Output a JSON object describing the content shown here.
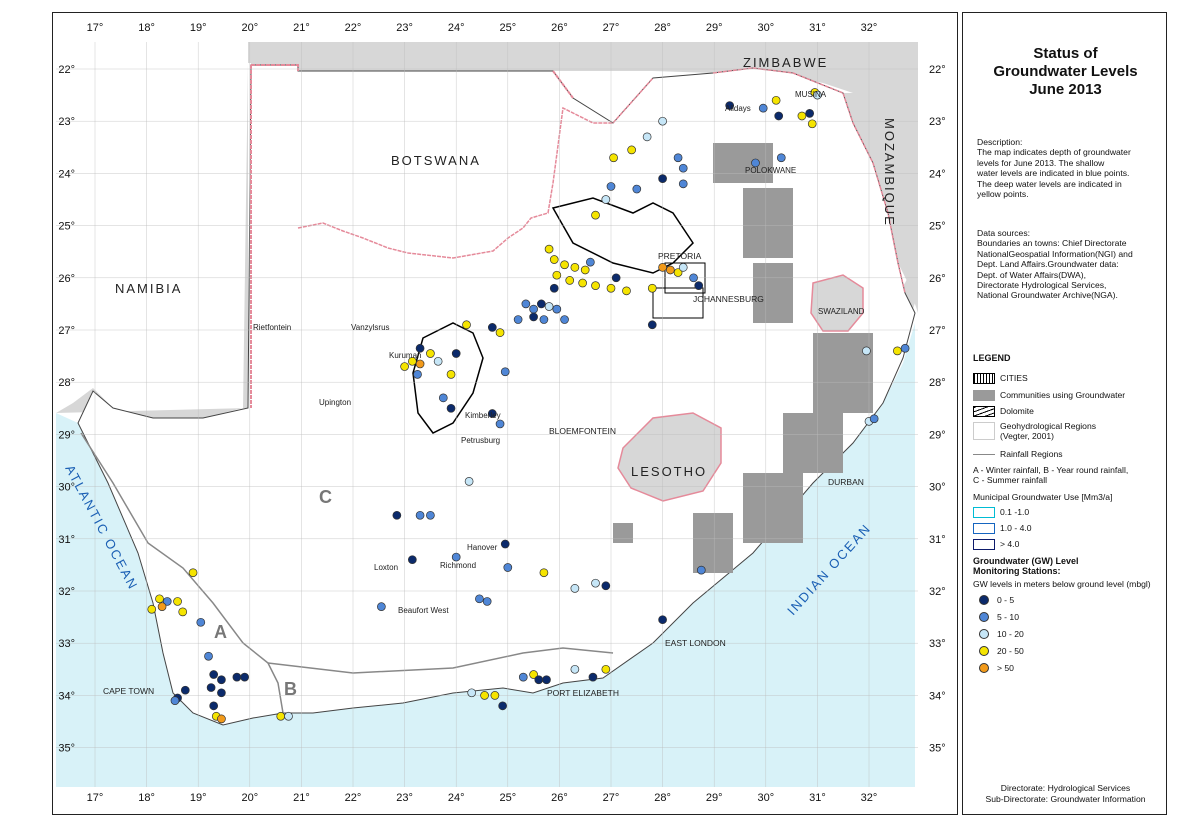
{
  "legend": {
    "title_lines": [
      "Status of",
      "Groundwater Levels",
      "June 2013"
    ],
    "description_lines": [
      "Description:",
      "The map indicates depth of groundwater",
      "levels for June 2013. The shallow",
      "water levels are indicated in blue points.",
      "The deep water levels are indicated in",
      "yellow points."
    ],
    "sources_lines": [
      "Data sources:",
      "Boundaries an towns: Chief Directorate",
      "NationalGeospatial Information(NGI) and",
      "Dept. Land Affairs.Groundwater data:",
      "Dept. of Water Affairs(DWA),",
      "Directorate Hydrological Services,",
      "National Groundwater Archive(NGA)."
    ],
    "heading": "LEGEND",
    "cities": "CITIES",
    "communities": "Communities using Groundwater",
    "dolomite": "Dolomite",
    "geohydro_lines": [
      "Geohydrological Regions",
      "(Vegter, 2001)"
    ],
    "rainfall": "Rainfall Regions",
    "rainfall_desc_lines": [
      "A - Winter rainfall, B - Year round rainfall,",
      "C - Summer rainfall"
    ],
    "municipal_heading": "Municipal Groundwater Use [Mm3/a]",
    "municipal_classes": [
      {
        "label": "0.1 -1.0",
        "color": "#00bcd4"
      },
      {
        "label": "1.0 - 4.0",
        "color": "#1565c0"
      },
      {
        "label": "> 4.0",
        "color": "#0d1b6b"
      }
    ],
    "gw_heading_lines": [
      "Groundwater (GW) Level",
      "Monitoring Stations:"
    ],
    "gw_sub": "GW levels in meters below ground level (mbgl)",
    "gw_classes": [
      {
        "label": "0 - 5",
        "color": "#0b2a6b"
      },
      {
        "label": "5 - 10",
        "color": "#4f86d6"
      },
      {
        "label": "10 - 20",
        "color": "#c6e6f7"
      },
      {
        "label": "20 - 50",
        "color": "#f5e400"
      },
      {
        "label": "> 50",
        "color": "#f29a1a"
      }
    ],
    "footer_lines": [
      "Directorate: Hydrological Services",
      "Sub-Directorate: Groundwater Information"
    ]
  },
  "map": {
    "x_ticks": [
      "17°",
      "18°",
      "19°",
      "20°",
      "21°",
      "22°",
      "23°",
      "24°",
      "25°",
      "26°",
      "27°",
      "28°",
      "29°",
      "30°",
      "31°",
      "32°"
    ],
    "y_ticks": [
      "22°",
      "23°",
      "24°",
      "25°",
      "26°",
      "27°",
      "28°",
      "29°",
      "30°",
      "31°",
      "32°",
      "33°",
      "34°",
      "35°"
    ],
    "countries": {
      "zimbabwe": "ZIMBABWE",
      "botswana": "BOTSWANA",
      "namibia": "NAMIBIA",
      "mozambique": "MOZAMBIQUE",
      "swaziland": "SWAZILAND",
      "lesotho": "LESOTHO"
    },
    "oceans": {
      "atlantic": "ATLANTIC OCEAN",
      "indian": "INDIAN OCEAN"
    },
    "rainfall_regions": {
      "a": "A",
      "b": "B",
      "c": "C"
    },
    "cities": {
      "pretoria": "PRETORIA",
      "johannesburg": "JOHANNESBURG",
      "bloemfontein": "BLOEMFONTEIN",
      "durban": "DURBAN",
      "east_london": "EAST LONDON",
      "port_elizabeth": "PORT ELIZABETH",
      "cape_town": "CAPE TOWN",
      "polokwane": "POLOKWANE"
    },
    "towns": {
      "musina": "MUSINA",
      "alldays": "Alldays",
      "rietfontein": "Rietfontein",
      "vanzylsrus": "Vanzylsrus",
      "kuruman": "Kuruman",
      "upington": "Upington",
      "kimberley": "Kimberley",
      "petrusburg": "Petrusburg",
      "hanover": "Hanover",
      "richmond": "Richmond",
      "loxton": "Loxton",
      "beaufort_west": "Beaufort West"
    }
  },
  "stations": [
    {
      "lon": 30.95,
      "lat": -22.45,
      "class": 4
    },
    {
      "lon": 31.0,
      "lat": -22.5,
      "class": 3
    },
    {
      "lon": 30.2,
      "lat": -22.6,
      "class": 4
    },
    {
      "lon": 29.3,
      "lat": -22.7,
      "class": 1
    },
    {
      "lon": 29.95,
      "lat": -22.75,
      "class": 2
    },
    {
      "lon": 30.7,
      "lat": -22.9,
      "class": 4
    },
    {
      "lon": 30.25,
      "lat": -22.9,
      "class": 1
    },
    {
      "lon": 30.85,
      "lat": -22.85,
      "class": 1
    },
    {
      "lon": 30.9,
      "lat": -23.05,
      "class": 4
    },
    {
      "lon": 28.0,
      "lat": -23.0,
      "class": 3
    },
    {
      "lon": 27.7,
      "lat": -23.3,
      "class": 3
    },
    {
      "lon": 27.4,
      "lat": -23.55,
      "class": 4
    },
    {
      "lon": 27.05,
      "lat": -23.7,
      "class": 4
    },
    {
      "lon": 28.3,
      "lat": -23.7,
      "class": 2
    },
    {
      "lon": 28.4,
      "lat": -23.9,
      "class": 2
    },
    {
      "lon": 29.8,
      "lat": -23.8,
      "class": 2
    },
    {
      "lon": 30.3,
      "lat": -23.7,
      "class": 2
    },
    {
      "lon": 28.0,
      "lat": -24.1,
      "class": 1
    },
    {
      "lon": 28.4,
      "lat": -24.2,
      "class": 2
    },
    {
      "lon": 27.0,
      "lat": -24.25,
      "class": 2
    },
    {
      "lon": 27.5,
      "lat": -24.3,
      "class": 2
    },
    {
      "lon": 26.9,
      "lat": -24.5,
      "class": 3
    },
    {
      "lon": 26.7,
      "lat": -24.8,
      "class": 4
    },
    {
      "lon": 25.8,
      "lat": -25.45,
      "class": 4
    },
    {
      "lon": 25.9,
      "lat": -25.65,
      "class": 4
    },
    {
      "lon": 26.1,
      "lat": -25.75,
      "class": 4
    },
    {
      "lon": 26.3,
      "lat": -25.8,
      "class": 4
    },
    {
      "lon": 26.5,
      "lat": -25.85,
      "class": 4
    },
    {
      "lon": 25.95,
      "lat": -25.95,
      "class": 4
    },
    {
      "lon": 26.2,
      "lat": -26.05,
      "class": 4
    },
    {
      "lon": 26.45,
      "lat": -26.1,
      "class": 4
    },
    {
      "lon": 26.7,
      "lat": -26.15,
      "class": 4
    },
    {
      "lon": 27.0,
      "lat": -26.2,
      "class": 4
    },
    {
      "lon": 27.3,
      "lat": -26.25,
      "class": 4
    },
    {
      "lon": 26.6,
      "lat": -25.7,
      "class": 2
    },
    {
      "lon": 25.9,
      "lat": -26.2,
      "class": 1
    },
    {
      "lon": 27.1,
      "lat": -26.0,
      "class": 1
    },
    {
      "lon": 28.0,
      "lat": -25.8,
      "class": 5
    },
    {
      "lon": 28.15,
      "lat": -25.85,
      "class": 5
    },
    {
      "lon": 28.3,
      "lat": -25.9,
      "class": 4
    },
    {
      "lon": 28.4,
      "lat": -25.8,
      "class": 3
    },
    {
      "lon": 28.6,
      "lat": -26.0,
      "class": 2
    },
    {
      "lon": 28.7,
      "lat": -26.15,
      "class": 1
    },
    {
      "lon": 27.8,
      "lat": -26.2,
      "class": 4
    },
    {
      "lon": 25.35,
      "lat": -26.5,
      "class": 2
    },
    {
      "lon": 25.5,
      "lat": -26.6,
      "class": 2
    },
    {
      "lon": 25.65,
      "lat": -26.5,
      "class": 1
    },
    {
      "lon": 25.8,
      "lat": -26.55,
      "class": 3
    },
    {
      "lon": 25.5,
      "lat": -26.75,
      "class": 1
    },
    {
      "lon": 25.7,
      "lat": -26.8,
      "class": 2
    },
    {
      "lon": 25.95,
      "lat": -26.6,
      "class": 2
    },
    {
      "lon": 25.2,
      "lat": -26.8,
      "class": 2
    },
    {
      "lon": 26.1,
      "lat": -26.8,
      "class": 2
    },
    {
      "lon": 27.8,
      "lat": -26.9,
      "class": 1
    },
    {
      "lon": 24.2,
      "lat": -26.9,
      "class": 4
    },
    {
      "lon": 24.7,
      "lat": -26.95,
      "class": 1
    },
    {
      "lon": 24.85,
      "lat": -27.05,
      "class": 4
    },
    {
      "lon": 23.3,
      "lat": -27.35,
      "class": 1
    },
    {
      "lon": 23.5,
      "lat": -27.45,
      "class": 4
    },
    {
      "lon": 23.15,
      "lat": -27.6,
      "class": 4
    },
    {
      "lon": 23.0,
      "lat": -27.7,
      "class": 4
    },
    {
      "lon": 23.3,
      "lat": -27.65,
      "class": 5
    },
    {
      "lon": 23.65,
      "lat": -27.6,
      "class": 3
    },
    {
      "lon": 23.25,
      "lat": -27.85,
      "class": 2
    },
    {
      "lon": 24.0,
      "lat": -27.45,
      "class": 1
    },
    {
      "lon": 23.9,
      "lat": -27.85,
      "class": 4
    },
    {
      "lon": 24.95,
      "lat": -27.8,
      "class": 2
    },
    {
      "lon": 23.75,
      "lat": -28.3,
      "class": 2
    },
    {
      "lon": 23.9,
      "lat": -28.5,
      "class": 1
    },
    {
      "lon": 24.7,
      "lat": -28.6,
      "class": 1
    },
    {
      "lon": 24.85,
      "lat": -28.8,
      "class": 2
    },
    {
      "lon": 31.95,
      "lat": -27.4,
      "class": 3
    },
    {
      "lon": 32.55,
      "lat": -27.4,
      "class": 4
    },
    {
      "lon": 32.7,
      "lat": -27.35,
      "class": 2
    },
    {
      "lon": 32.0,
      "lat": -28.75,
      "class": 3
    },
    {
      "lon": 32.1,
      "lat": -28.7,
      "class": 2
    },
    {
      "lon": 24.25,
      "lat": -29.9,
      "class": 3
    },
    {
      "lon": 22.85,
      "lat": -30.55,
      "class": 1
    },
    {
      "lon": 23.3,
      "lat": -30.55,
      "class": 2
    },
    {
      "lon": 23.5,
      "lat": -30.55,
      "class": 2
    },
    {
      "lon": 24.95,
      "lat": -31.1,
      "class": 1
    },
    {
      "lon": 24.0,
      "lat": -31.35,
      "class": 2
    },
    {
      "lon": 25.0,
      "lat": -31.55,
      "class": 2
    },
    {
      "lon": 23.15,
      "lat": -31.4,
      "class": 1
    },
    {
      "lon": 25.7,
      "lat": -31.65,
      "class": 4
    },
    {
      "lon": 26.7,
      "lat": -31.85,
      "class": 3
    },
    {
      "lon": 26.9,
      "lat": -31.9,
      "class": 1
    },
    {
      "lon": 26.3,
      "lat": -31.95,
      "class": 3
    },
    {
      "lon": 28.75,
      "lat": -31.6,
      "class": 2
    },
    {
      "lon": 22.55,
      "lat": -32.3,
      "class": 2
    },
    {
      "lon": 24.45,
      "lat": -32.15,
      "class": 2
    },
    {
      "lon": 24.6,
      "lat": -32.2,
      "class": 2
    },
    {
      "lon": 28.0,
      "lat": -32.55,
      "class": 1
    },
    {
      "lon": 18.9,
      "lat": -31.65,
      "class": 4
    },
    {
      "lon": 18.25,
      "lat": -32.15,
      "class": 4
    },
    {
      "lon": 18.4,
      "lat": -32.2,
      "class": 2
    },
    {
      "lon": 18.6,
      "lat": -32.2,
      "class": 4
    },
    {
      "lon": 18.1,
      "lat": -32.35,
      "class": 4
    },
    {
      "lon": 18.3,
      "lat": -32.3,
      "class": 5
    },
    {
      "lon": 18.7,
      "lat": -32.4,
      "class": 4
    },
    {
      "lon": 19.05,
      "lat": -32.6,
      "class": 2
    },
    {
      "lon": 19.2,
      "lat": -33.25,
      "class": 2
    },
    {
      "lon": 19.3,
      "lat": -33.6,
      "class": 1
    },
    {
      "lon": 19.45,
      "lat": -33.7,
      "class": 1
    },
    {
      "lon": 19.75,
      "lat": -33.65,
      "class": 1
    },
    {
      "lon": 19.9,
      "lat": -33.65,
      "class": 1
    },
    {
      "lon": 19.25,
      "lat": -33.85,
      "class": 1
    },
    {
      "lon": 19.45,
      "lat": -33.95,
      "class": 1
    },
    {
      "lon": 18.75,
      "lat": -33.9,
      "class": 1
    },
    {
      "lon": 18.6,
      "lat": -34.05,
      "class": 1
    },
    {
      "lon": 18.55,
      "lat": -34.1,
      "class": 2
    },
    {
      "lon": 19.3,
      "lat": -34.2,
      "class": 1
    },
    {
      "lon": 19.35,
      "lat": -34.4,
      "class": 4
    },
    {
      "lon": 19.45,
      "lat": -34.45,
      "class": 5
    },
    {
      "lon": 20.6,
      "lat": -34.4,
      "class": 4
    },
    {
      "lon": 20.75,
      "lat": -34.4,
      "class": 3
    },
    {
      "lon": 24.3,
      "lat": -33.95,
      "class": 3
    },
    {
      "lon": 24.55,
      "lat": -34.0,
      "class": 4
    },
    {
      "lon": 24.75,
      "lat": -34.0,
      "class": 4
    },
    {
      "lon": 24.9,
      "lat": -34.2,
      "class": 1
    },
    {
      "lon": 25.3,
      "lat": -33.65,
      "class": 2
    },
    {
      "lon": 25.5,
      "lat": -33.6,
      "class": 4
    },
    {
      "lon": 25.6,
      "lat": -33.7,
      "class": 1
    },
    {
      "lon": 25.75,
      "lat": -33.7,
      "class": 1
    },
    {
      "lon": 26.3,
      "lat": -33.5,
      "class": 3
    },
    {
      "lon": 26.65,
      "lat": -33.65,
      "class": 1
    },
    {
      "lon": 26.9,
      "lat": -33.5,
      "class": 4
    }
  ]
}
